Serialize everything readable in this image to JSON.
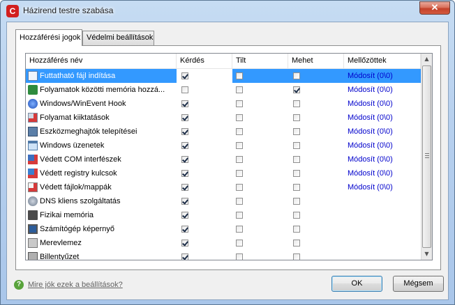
{
  "window": {
    "title": "Házirend testre szabása",
    "app_icon_letter": "C",
    "close_glyph": "✕"
  },
  "tabs": [
    {
      "label": "Hozzáférési jogok",
      "active": true
    },
    {
      "label": "Védelmi beállítások",
      "active": false
    }
  ],
  "list": {
    "columns": [
      "Hozzáférés név",
      "Kérdés",
      "Tilt",
      "Mehet",
      "Mellőzöttek"
    ],
    "rows": [
      {
        "name": "Futtatható fájl indítása",
        "icon": "executable-icon",
        "kerdes": true,
        "tilt": false,
        "mehet": false,
        "mellozottek": "Módosít (0\\0)",
        "selected": true
      },
      {
        "name": "Folyamatok közötti memória hozzá...",
        "icon": "memory-access-icon",
        "kerdes": false,
        "tilt": false,
        "mehet": true,
        "mellozottek": "Módosít (0\\0)",
        "selected": false
      },
      {
        "name": "Windows/WinEvent Hook",
        "icon": "hook-icon",
        "kerdes": true,
        "tilt": false,
        "mehet": false,
        "mellozottek": "Módosít (0\\0)",
        "selected": false
      },
      {
        "name": "Folyamat kiiktatások",
        "icon": "process-kill-icon",
        "kerdes": true,
        "tilt": false,
        "mehet": false,
        "mellozottek": "Módosít (0\\0)",
        "selected": false
      },
      {
        "name": "Eszközmeghajtók telepítései",
        "icon": "driver-install-icon",
        "kerdes": true,
        "tilt": false,
        "mehet": false,
        "mellozottek": "Módosít (0\\0)",
        "selected": false
      },
      {
        "name": "Windows üzenetek",
        "icon": "window-message-icon",
        "kerdes": true,
        "tilt": false,
        "mehet": false,
        "mellozottek": "Módosít (0\\0)",
        "selected": false
      },
      {
        "name": "Védett COM interfészek",
        "icon": "com-interface-icon",
        "kerdes": true,
        "tilt": false,
        "mehet": false,
        "mellozottek": "Módosít (0\\0)",
        "selected": false
      },
      {
        "name": "Védett registry kulcsok",
        "icon": "registry-icon",
        "kerdes": true,
        "tilt": false,
        "mehet": false,
        "mellozottek": "Módosít (0\\0)",
        "selected": false
      },
      {
        "name": "Védett fájlok/mappák",
        "icon": "protected-file-icon",
        "kerdes": true,
        "tilt": false,
        "mehet": false,
        "mellozottek": "Módosít (0\\0)",
        "selected": false
      },
      {
        "name": "DNS kliens szolgáltatás",
        "icon": "dns-icon",
        "kerdes": true,
        "tilt": false,
        "mehet": false,
        "mellozottek": "",
        "selected": false
      },
      {
        "name": "Fizikai memória",
        "icon": "physical-memory-icon",
        "kerdes": true,
        "tilt": false,
        "mehet": false,
        "mellozottek": "",
        "selected": false
      },
      {
        "name": "Számítógép képernyő",
        "icon": "monitor-icon",
        "kerdes": true,
        "tilt": false,
        "mehet": false,
        "mellozottek": "",
        "selected": false
      },
      {
        "name": "Merevlemez",
        "icon": "hard-disk-icon",
        "kerdes": true,
        "tilt": false,
        "mehet": false,
        "mellozottek": "",
        "selected": false
      },
      {
        "name": "Billentyűzet",
        "icon": "keyboard-icon",
        "kerdes": true,
        "tilt": false,
        "mehet": false,
        "mellozottek": "",
        "selected": false
      }
    ]
  },
  "footer": {
    "help_icon": "?",
    "help_link": "Mire jók ezek a beállítások?",
    "ok_label": "OK",
    "cancel_label": "Mégsem"
  },
  "colors": {
    "selection": "#3399ff",
    "link": "#0000cc"
  }
}
